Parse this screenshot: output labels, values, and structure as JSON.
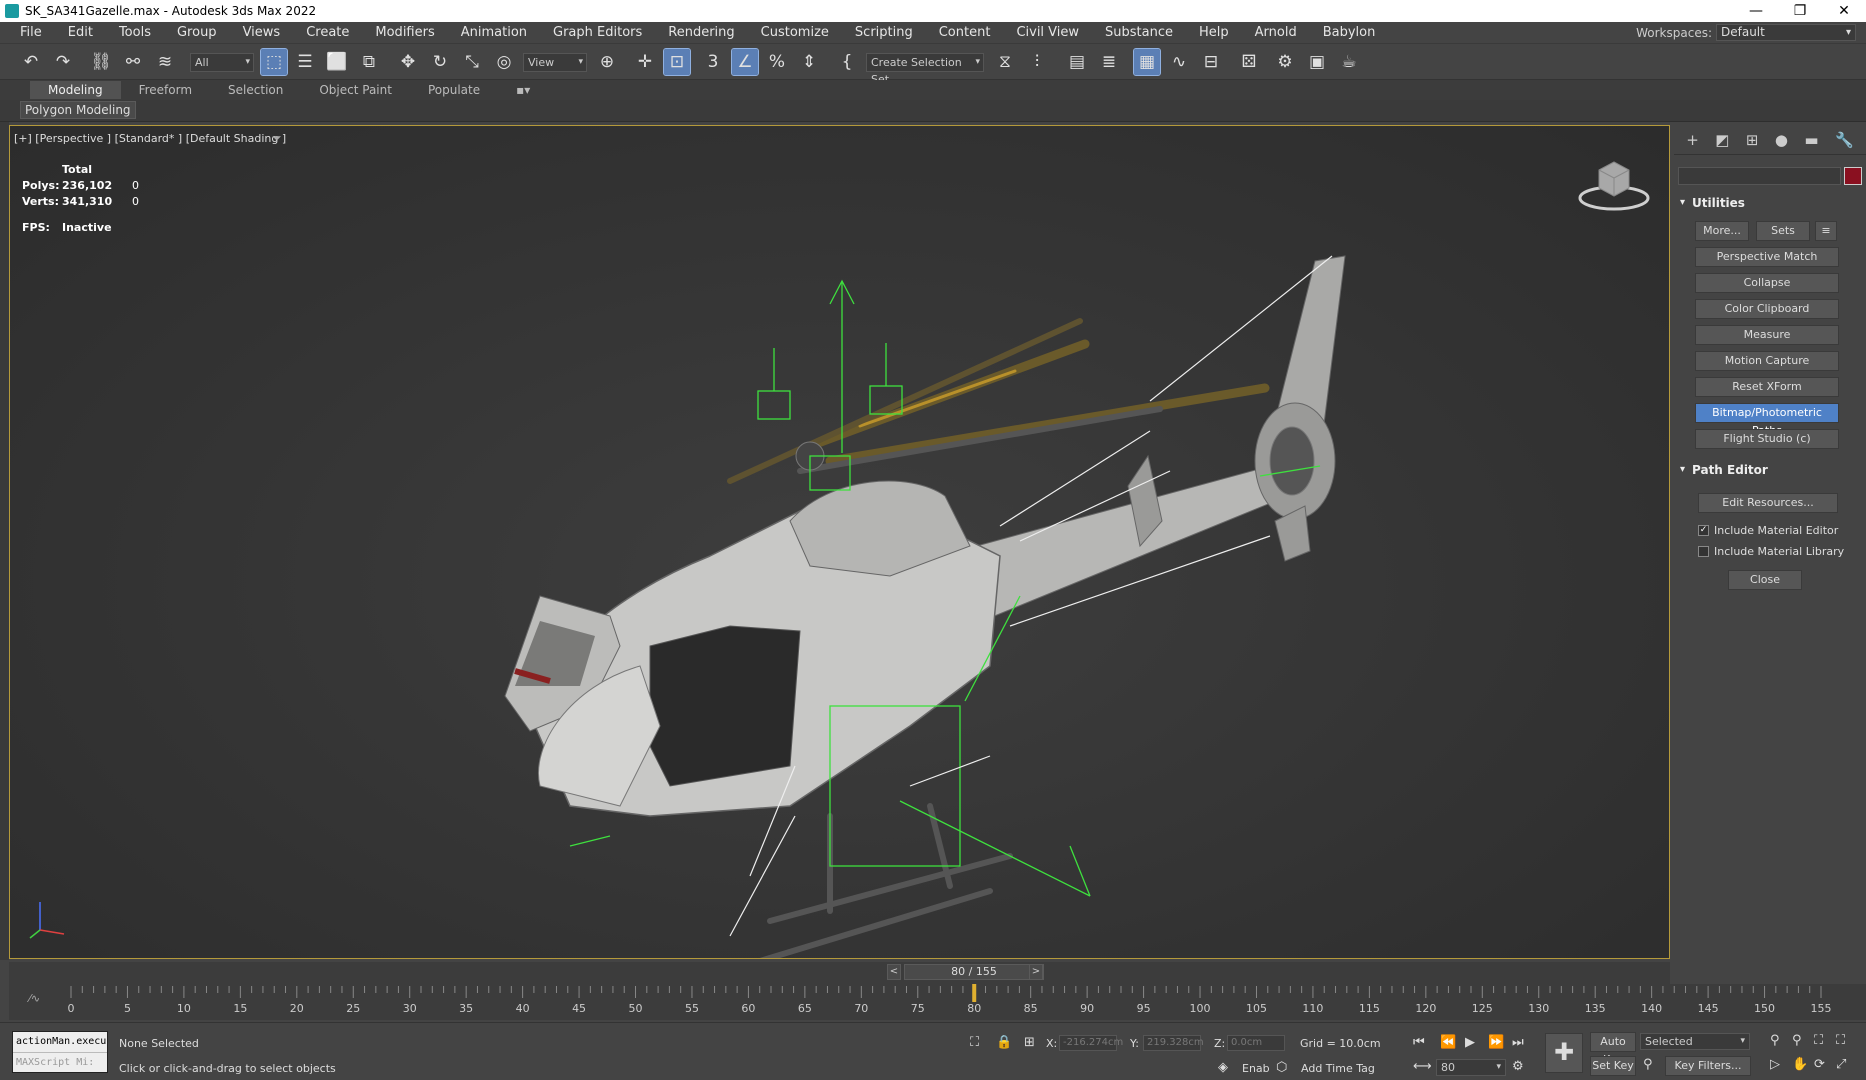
{
  "window": {
    "title": "SK_SA341Gazelle.max - Autodesk 3ds Max 2022"
  },
  "menu": [
    "File",
    "Edit",
    "Tools",
    "Group",
    "Views",
    "Create",
    "Modifiers",
    "Animation",
    "Graph Editors",
    "Rendering",
    "Customize",
    "Scripting",
    "Content",
    "Civil View",
    "Substance",
    "Help",
    "Arnold",
    "Babylon"
  ],
  "workspace": {
    "label": "Workspaces:",
    "value": "Default"
  },
  "toolbar": {
    "filter": "All",
    "ref_coord": "View",
    "selection_set": "Create Selection Set"
  },
  "ribbon": {
    "tabs": [
      "Modeling",
      "Freeform",
      "Selection",
      "Object Paint",
      "Populate"
    ],
    "active_panel": "Polygon Modeling"
  },
  "viewport": {
    "label": "[+] [Perspective ] [Standard* ] [Default Shading ]",
    "stats": {
      "header": "Total",
      "polys_label": "Polys:",
      "polys": "236,102",
      "polys_sel": "0",
      "verts_label": "Verts:",
      "verts": "341,310",
      "verts_sel": "0",
      "fps_label": "FPS:",
      "fps": "Inactive"
    }
  },
  "command_panel": {
    "utilities_title": "Utilities",
    "more": "More...",
    "sets": "Sets",
    "buttons": [
      "Perspective Match",
      "Collapse",
      "Color Clipboard",
      "Measure",
      "Motion Capture",
      "Reset XForm",
      "Bitmap/Photometric Paths",
      "Flight Studio (c)"
    ],
    "path_editor_title": "Path Editor",
    "edit_resources": "Edit Resources...",
    "chk_material_editor": "Include Material Editor",
    "chk_material_library": "Include Material Library",
    "close": "Close"
  },
  "timeline": {
    "frame_display": "80 / 155",
    "current": 80,
    "max": 155,
    "ticks": [
      "0",
      "5",
      "10",
      "15",
      "20",
      "25",
      "30",
      "35",
      "40",
      "45",
      "50",
      "55",
      "60",
      "65",
      "70",
      "75",
      "80",
      "85",
      "90",
      "95",
      "100",
      "105",
      "110",
      "115",
      "120",
      "125",
      "130",
      "135",
      "140",
      "145",
      "150",
      "155"
    ]
  },
  "status": {
    "listener_line1": "actionMan.execu",
    "listener_line2": "MAXScript Mi:",
    "selection": "None Selected",
    "prompt": "Click or click-and-drag to select objects",
    "x_label": "X:",
    "x": "-216.274cm",
    "y_label": "Y:",
    "y": "219.328cm",
    "z_label": "Z:",
    "z": "0.0cm",
    "grid": "Grid = 10.0cm",
    "enable": "Enab",
    "add_time_tag": "Add Time Tag",
    "auto_key": "Auto Key",
    "set_key": "Set Key",
    "key_mode": "Selected",
    "key_filters": "Key Filters...",
    "frame": "80"
  }
}
